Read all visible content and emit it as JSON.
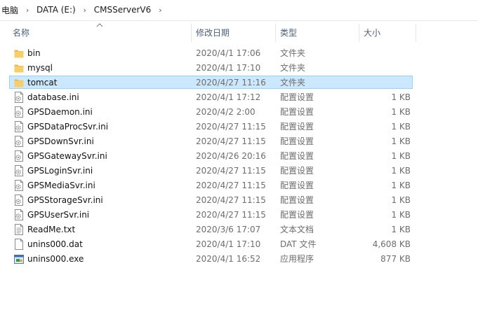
{
  "breadcrumb": [
    "电脑",
    "DATA (E:)",
    "CMSServerV6"
  ],
  "columns": {
    "name": "名称",
    "date": "修改日期",
    "type": "类型",
    "size": "大小"
  },
  "files": [
    {
      "name": "bin",
      "date": "2020/4/1 17:06",
      "type": "文件夹",
      "size": "",
      "icon": "folder-icon",
      "selected": false
    },
    {
      "name": "mysql",
      "date": "2020/4/1 17:10",
      "type": "文件夹",
      "size": "",
      "icon": "folder-icon",
      "selected": false
    },
    {
      "name": "tomcat",
      "date": "2020/4/27 11:16",
      "type": "文件夹",
      "size": "",
      "icon": "folder-icon",
      "selected": true
    },
    {
      "name": "database.ini",
      "date": "2020/4/1 17:12",
      "type": "配置设置",
      "size": "1 KB",
      "icon": "config-file-icon",
      "selected": false
    },
    {
      "name": "GPSDaemon.ini",
      "date": "2020/4/2 2:00",
      "type": "配置设置",
      "size": "1 KB",
      "icon": "config-file-icon",
      "selected": false
    },
    {
      "name": "GPSDataProcSvr.ini",
      "date": "2020/4/27 11:15",
      "type": "配置设置",
      "size": "1 KB",
      "icon": "config-file-icon",
      "selected": false
    },
    {
      "name": "GPSDownSvr.ini",
      "date": "2020/4/27 11:15",
      "type": "配置设置",
      "size": "1 KB",
      "icon": "config-file-icon",
      "selected": false
    },
    {
      "name": "GPSGatewaySvr.ini",
      "date": "2020/4/26 20:16",
      "type": "配置设置",
      "size": "1 KB",
      "icon": "config-file-icon",
      "selected": false
    },
    {
      "name": "GPSLoginSvr.ini",
      "date": "2020/4/27 11:15",
      "type": "配置设置",
      "size": "1 KB",
      "icon": "config-file-icon",
      "selected": false
    },
    {
      "name": "GPSMediaSvr.ini",
      "date": "2020/4/27 11:15",
      "type": "配置设置",
      "size": "1 KB",
      "icon": "config-file-icon",
      "selected": false
    },
    {
      "name": "GPSStorageSvr.ini",
      "date": "2020/4/27 11:15",
      "type": "配置设置",
      "size": "1 KB",
      "icon": "config-file-icon",
      "selected": false
    },
    {
      "name": "GPSUserSvr.ini",
      "date": "2020/4/27 11:15",
      "type": "配置设置",
      "size": "1 KB",
      "icon": "config-file-icon",
      "selected": false
    },
    {
      "name": "ReadMe.txt",
      "date": "2020/3/6 17:07",
      "type": "文本文档",
      "size": "1 KB",
      "icon": "text-file-icon",
      "selected": false
    },
    {
      "name": "unins000.dat",
      "date": "2020/4/1 17:10",
      "type": "DAT 文件",
      "size": "4,608 KB",
      "icon": "blank-file-icon",
      "selected": false
    },
    {
      "name": "unins000.exe",
      "date": "2020/4/1 16:52",
      "type": "应用程序",
      "size": "877 KB",
      "icon": "application-icon",
      "selected": false
    }
  ],
  "colors": {
    "selection": "#cce8ff",
    "selection_border": "#99d1ff",
    "header_text": "#4c607a",
    "folder": "#f2c55c"
  }
}
